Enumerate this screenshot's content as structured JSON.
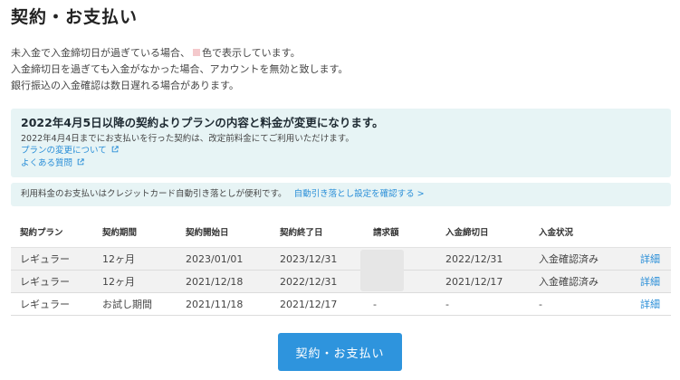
{
  "page": {
    "title": "契約・お支払い"
  },
  "notes": {
    "line1_before": "未入金で入金締切日が過ぎている場合、",
    "line1_after": "色で表示しています。",
    "line2": "入金締切日を過ぎても入金がなかった場合、アカウントを無効と致します。",
    "line3": "銀行振込の入金確認は数日遅れる場合があります。",
    "marker_color": "#f4c9cc"
  },
  "notice": {
    "title": "2022年4月5日以降の契約よりプランの内容と料金が変更になります。",
    "body": "2022年4月4日までにお支払いを行った契約は、改定前料金にてご利用いただけます。",
    "links": [
      {
        "label": "プランの変更について",
        "icon": "external-link-icon"
      },
      {
        "label": "よくある質問",
        "icon": "external-link-icon"
      }
    ]
  },
  "auto_pay": {
    "text": "利用料金のお支払いはクレジットカード自動引き落としが便利です。",
    "link": "自動引き落とし設定を確認する >"
  },
  "table": {
    "headers": [
      "契約プラン",
      "契約期間",
      "契約開始日",
      "契約終了日",
      "請求額",
      "入金締切日",
      "入金状況",
      ""
    ],
    "rows": [
      {
        "plan": "レギュラー",
        "period": "12ヶ月",
        "start": "2023/01/01",
        "end": "2023/12/31",
        "amount": "",
        "deadline": "2022/12/31",
        "status": "入金確認済み",
        "detail": "詳細"
      },
      {
        "plan": "レギュラー",
        "period": "12ヶ月",
        "start": "2021/12/18",
        "end": "2022/12/31",
        "amount": "",
        "deadline": "2021/12/17",
        "status": "入金確認済み",
        "detail": "詳細"
      },
      {
        "plan": "レギュラー",
        "period": "お試し期間",
        "start": "2021/11/18",
        "end": "2021/12/17",
        "amount": "-",
        "deadline": "-",
        "status": "-",
        "detail": "詳細"
      }
    ]
  },
  "action": {
    "label": "契約・お支払い"
  },
  "colors": {
    "accent": "#2e94dd",
    "link": "#2b8fd8",
    "notice_bg": "#e7f4f5",
    "row_shade": "#f2f2f2"
  }
}
